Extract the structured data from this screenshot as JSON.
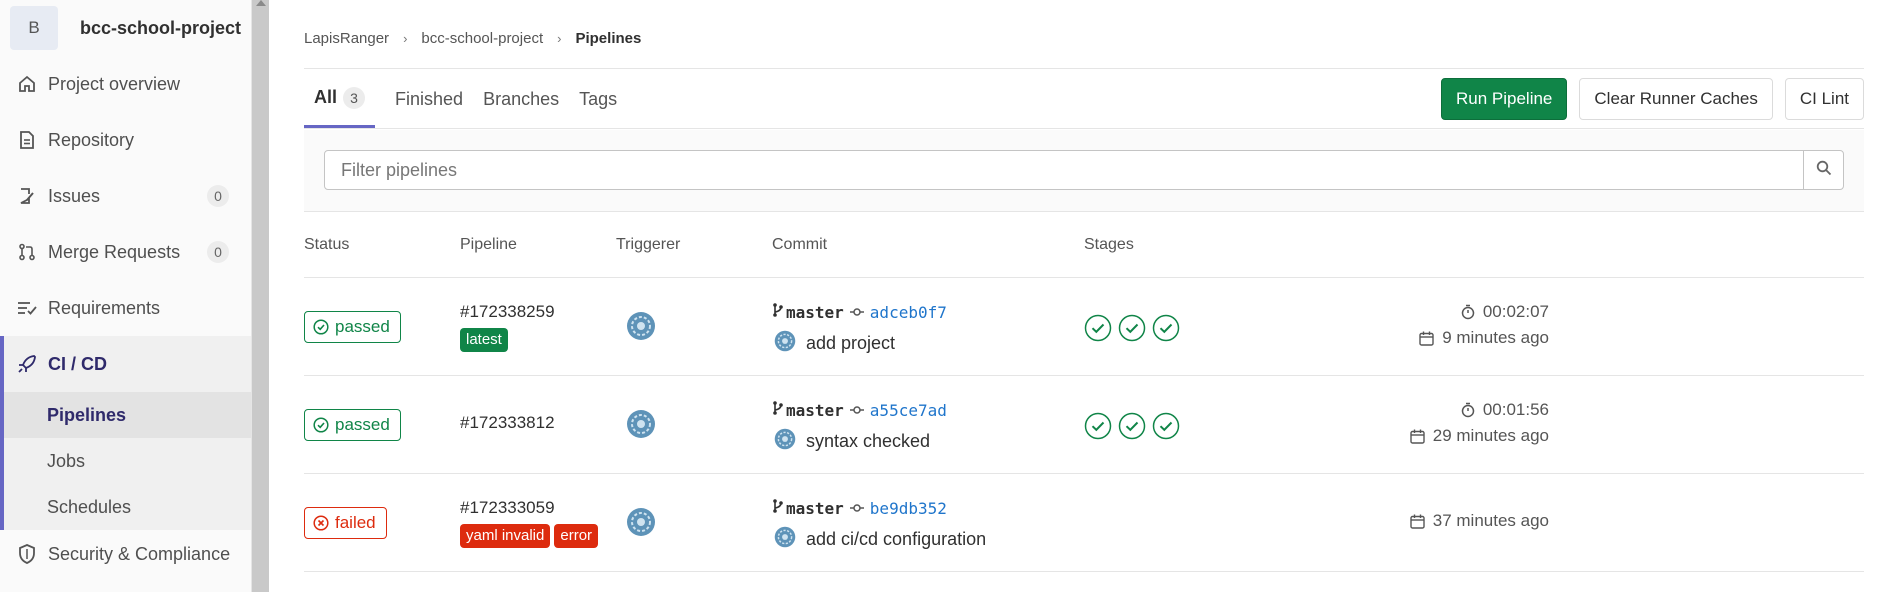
{
  "sidebar": {
    "avatar_letter": "B",
    "project_name": "bcc-school-project",
    "items": [
      {
        "label": "Project overview",
        "icon": "home-icon"
      },
      {
        "label": "Repository",
        "icon": "document-icon"
      },
      {
        "label": "Issues",
        "icon": "issues-icon",
        "count": "0"
      },
      {
        "label": "Merge Requests",
        "icon": "merge-request-icon",
        "count": "0"
      },
      {
        "label": "Requirements",
        "icon": "requirements-icon"
      },
      {
        "label": "CI / CD",
        "icon": "rocket-icon"
      }
    ],
    "sub_items": [
      {
        "label": "Pipelines"
      },
      {
        "label": "Jobs"
      },
      {
        "label": "Schedules"
      }
    ],
    "security": {
      "label": "Security & Compliance",
      "icon": "shield-icon"
    }
  },
  "breadcrumb": {
    "user": "LapisRanger",
    "project": "bcc-school-project",
    "current": "Pipelines"
  },
  "tabs": [
    {
      "label": "All",
      "count": "3"
    },
    {
      "label": "Finished"
    },
    {
      "label": "Branches"
    },
    {
      "label": "Tags"
    }
  ],
  "actions": {
    "run_pipeline": "Run Pipeline",
    "clear_caches": "Clear Runner Caches",
    "ci_lint": "CI Lint"
  },
  "filter": {
    "placeholder": "Filter pipelines"
  },
  "table": {
    "headers": {
      "status": "Status",
      "pipeline": "Pipeline",
      "triggerer": "Triggerer",
      "commit": "Commit",
      "stages": "Stages"
    },
    "rows": [
      {
        "status": "passed",
        "pipeline_id": "#172338259",
        "labels": [
          "latest"
        ],
        "branch": "master",
        "sha": "adceb0f7",
        "message": "add project",
        "duration": "00:02:07",
        "finished": "9 minutes ago"
      },
      {
        "status": "passed",
        "pipeline_id": "#172333812",
        "labels": [],
        "branch": "master",
        "sha": "a55ce7ad",
        "message": "syntax checked",
        "duration": "00:01:56",
        "finished": "29 minutes ago"
      },
      {
        "status": "failed",
        "pipeline_id": "#172333059",
        "labels": [
          "yaml invalid",
          "error"
        ],
        "branch": "master",
        "sha": "be9db352",
        "message": "add ci/cd configuration",
        "duration": "",
        "finished": "37 minutes ago"
      }
    ]
  },
  "colors": {
    "success": "#108548",
    "danger": "#dd2b0e",
    "accent": "#6666c4",
    "link": "#1f75cb"
  }
}
